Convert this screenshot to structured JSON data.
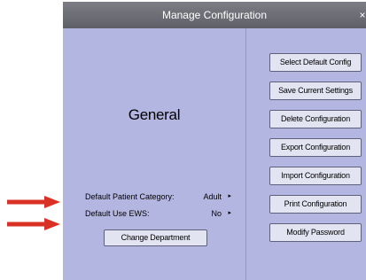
{
  "dialog": {
    "title": "Manage Configuration",
    "close_glyph": "×"
  },
  "general": {
    "title": "General",
    "settings": [
      {
        "label": "Default Patient Category:",
        "value": "Adult",
        "arrow": "▸"
      },
      {
        "label": "Default Use EWS:",
        "value": "No",
        "arrow": "▸"
      }
    ],
    "change_department_label": "Change Department"
  },
  "actions": [
    "Select Default Config",
    "Save Current Settings",
    "Delete Configuration",
    "Export Configuration",
    "Import Configuration",
    "Print Configuration",
    "Modify Password"
  ],
  "annotation_arrows": {
    "color": "#d93224",
    "icon": "arrow-right-icon"
  }
}
